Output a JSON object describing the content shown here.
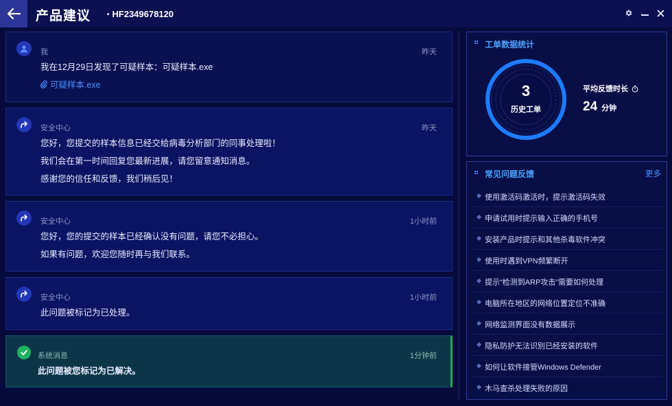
{
  "header": {
    "title": "产品建议",
    "ticket_id": "HF2349678120"
  },
  "messages": [
    {
      "sender": "我",
      "time": "昨天",
      "lines": [
        "我在12月29日发现了可疑样本：可疑样本.exe"
      ],
      "attachment": "可疑样本.exe"
    },
    {
      "sender": "安全中心",
      "time": "昨天",
      "lines": [
        "您好，您提交的样本信息已经交给病毒分析部门的同事处理啦！",
        "我们会在第一时间回复您最新进展，请您留意通知消息。",
        "感谢您的信任和反馈，我们稍后见！"
      ]
    },
    {
      "sender": "安全中心",
      "time": "1小时前",
      "lines": [
        "您好，您的提交的样本已经确认没有问题，请您不必担心。",
        "如果有问题，欢迎您随时再与我们联系。"
      ]
    },
    {
      "sender": "安全中心",
      "time": "1小时前",
      "lines": [
        "此问题被标记为已处理。"
      ]
    },
    {
      "sender": "系统消息",
      "time": "1分钟前",
      "lines": [
        "此问题被您标记为已解决。"
      ]
    }
  ],
  "stats": {
    "title": "工单数据统计",
    "history_count": "3",
    "history_label": "历史工单",
    "avg_label": "平均反馈时长",
    "avg_value": "24",
    "avg_unit": "分钟"
  },
  "faq": {
    "title": "常见问题反馈",
    "more": "更多",
    "items": [
      "使用激活码激活时，提示激活码失效",
      "申请试用时提示输入正确的手机号",
      "安装产品时提示和其他杀毒软件冲突",
      "使用时遇到VPN频繁断开",
      "提示“检测到ARP攻击”需要如何处理",
      "电脑所在地区的网络位置定位不准确",
      "网络监测界面没有数据展示",
      "隐私防护无法识别已经安装的软件",
      "如何让软件接管Windows Defender",
      "木马查杀处理失败的原因"
    ]
  },
  "colors": {
    "accent": "#4a8dff",
    "background": "#070b3c",
    "success": "#1fb163",
    "ring": "#1e7bff"
  },
  "icons": {
    "back": "arrow-left-icon",
    "settings": "gear-icon",
    "minimize": "minimize-icon",
    "close": "close-icon",
    "user": "user-icon",
    "reply": "reply-arrow-icon",
    "attachment": "paperclip-icon",
    "check": "check-icon",
    "timer": "stopwatch-icon"
  }
}
